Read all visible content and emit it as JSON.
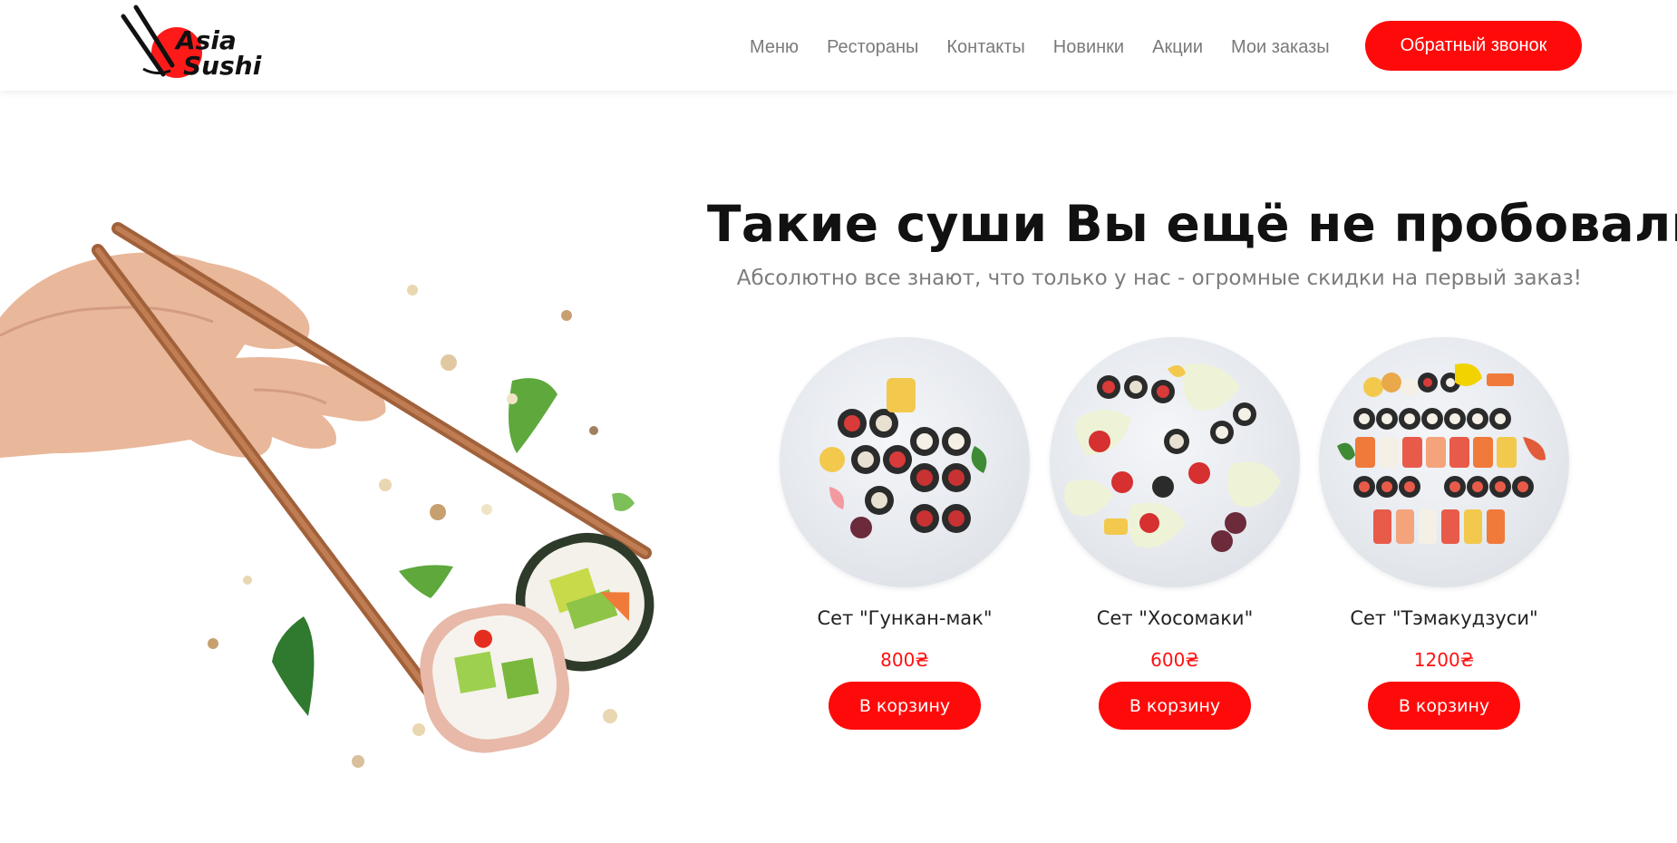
{
  "brand": {
    "line1": "Asia",
    "line2": "Sushi",
    "accent": "#ff0a0a"
  },
  "nav": {
    "items": [
      "Меню",
      "Рестораны",
      "Контакты",
      "Новинки",
      "Акции",
      "Мои заказы"
    ],
    "callback_label": "Обратный звонок"
  },
  "hero": {
    "title": "Такие суши Вы ещё не пробовали",
    "subtitle": "Абсолютно все знают, что только у нас - огромные скидки на первый заказ!"
  },
  "products": [
    {
      "title": "Сет \"Гункан-мак\"",
      "price": "800₴",
      "button": "В корзину"
    },
    {
      "title": "Сет \"Хосомаки\"",
      "price": "600₴",
      "button": "В корзину"
    },
    {
      "title": "Сет \"Тэмакудзуси\"",
      "price": "1200₴",
      "button": "В корзину"
    }
  ],
  "colors": {
    "accent": "#ff0a0a",
    "price": "#ff1111",
    "nav": "#7a7a7a"
  }
}
